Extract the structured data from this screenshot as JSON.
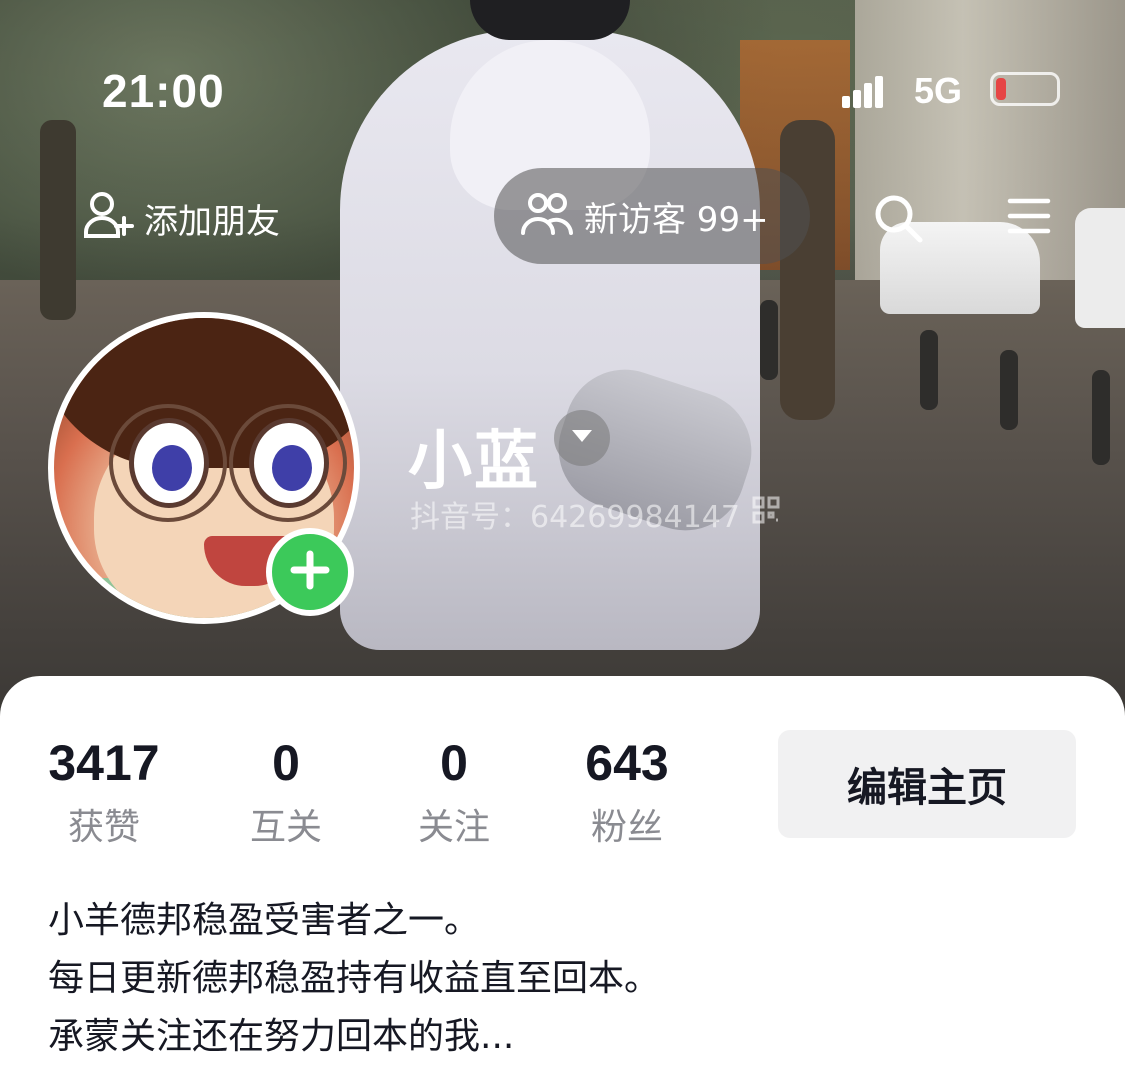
{
  "status_bar": {
    "time": "21:00",
    "network": "5G"
  },
  "nav": {
    "add_friend_label": "添加朋友",
    "visitors_label": "新访客 99+",
    "search_icon": "search-icon",
    "menu_icon": "hamburger-menu-icon"
  },
  "profile": {
    "name": "小蓝",
    "douyin_id": "抖音号：64269984147",
    "avatar_icon": "avatar",
    "badge_icon": "plus-icon"
  },
  "stats": [
    {
      "value": "3417",
      "label": "获赞"
    },
    {
      "value": "0",
      "label": "互关"
    },
    {
      "value": "0",
      "label": "关注"
    },
    {
      "value": "643",
      "label": "粉丝"
    }
  ],
  "edit_profile_label": "编辑主页",
  "bio": [
    "小羊德邦稳盈受害者之一。",
    "每日更新德邦稳盈持有收益直至回本。",
    "承蒙关注还在努力回本的我..."
  ],
  "colors": {
    "badge_green": "#3cc95a",
    "text_dark": "#161823",
    "text_gray": "#8a8b91",
    "button_bg": "#f1f1f2"
  }
}
